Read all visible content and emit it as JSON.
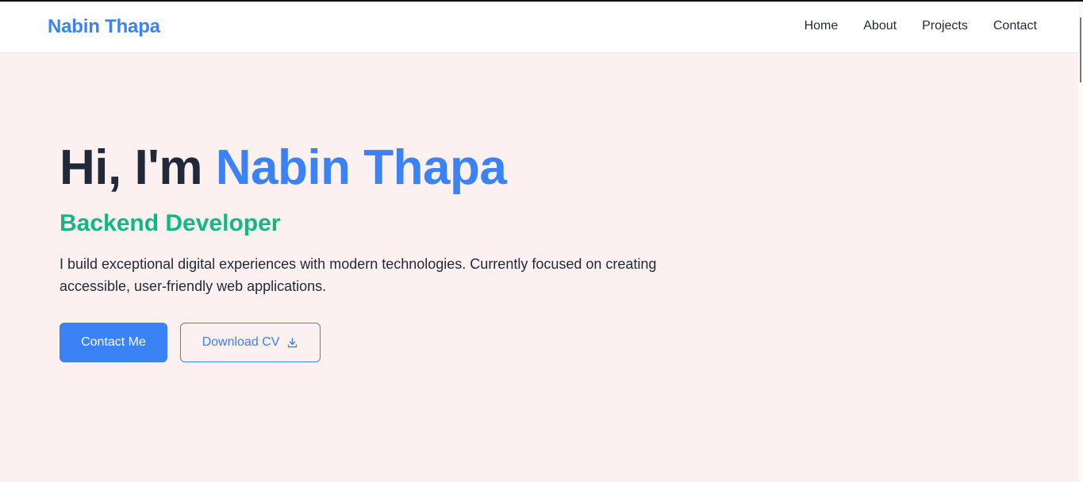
{
  "nav": {
    "brand": "Nabin Thapa",
    "links": [
      "Home",
      "About",
      "Projects",
      "Contact"
    ]
  },
  "hero": {
    "greeting": "Hi, I'm ",
    "name": "Nabin Thapa",
    "subtitle": "Backend Developer",
    "description": "I build exceptional digital experiences with modern technologies. Currently focused on creating accessible, user-friendly web applications.",
    "primary_button": "Contact Me",
    "secondary_button": "Download CV",
    "secondary_button_icon": "download-icon"
  },
  "colors": {
    "accent": "#3b82f6",
    "subtitle": "#10b981",
    "background": "#fdf0f0",
    "text": "#1f2937"
  }
}
